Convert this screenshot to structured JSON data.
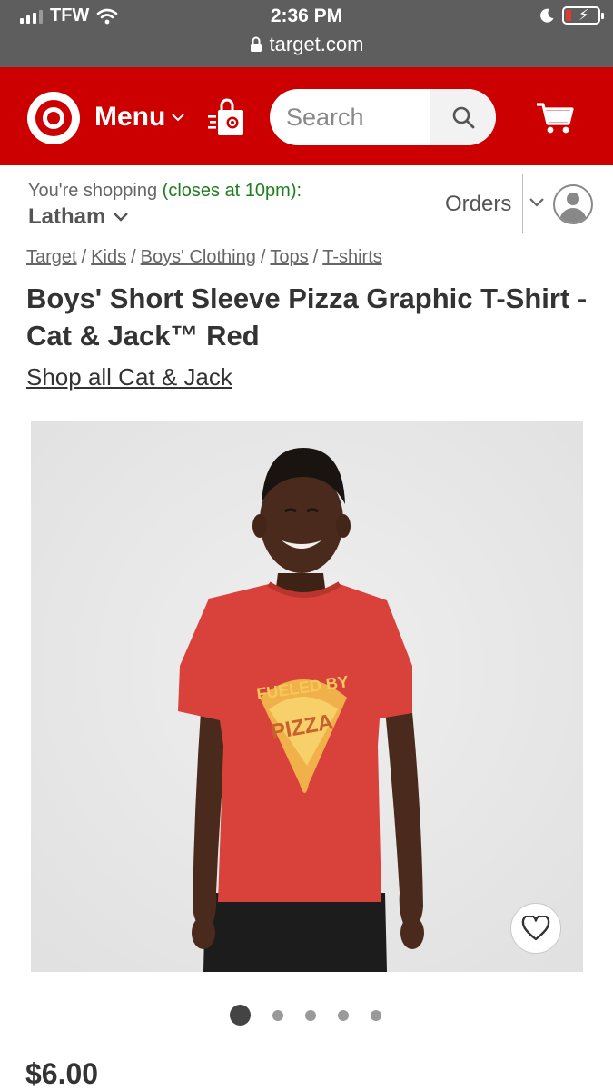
{
  "status_bar": {
    "carrier": "TFW",
    "time": "2:36 PM",
    "url": "target.com"
  },
  "header": {
    "menu_label": "Menu",
    "search_placeholder": "Search",
    "brand_color": "#cc0000"
  },
  "store": {
    "shopping_prefix": "You're shopping",
    "hours": "(closes at 10pm):",
    "store_name": "Latham",
    "orders_label": "Orders"
  },
  "breadcrumb": [
    "Target",
    "Kids",
    "Boys' Clothing",
    "Tops",
    "T-shirts"
  ],
  "product": {
    "title": "Boys' Short Sleeve Pizza Graphic T-Shirt - Cat & Jack™ Red",
    "shop_all_link": "Shop all Cat & Jack",
    "shirt_graphic_text_1": "FUELED BY",
    "shirt_graphic_text_2": "PIZZA",
    "price": "$6.00"
  },
  "carousel": {
    "total_images": 5,
    "active_index": 0
  },
  "icons": {
    "signal": "signal-icon",
    "wifi": "wifi-icon",
    "lock": "lock-icon",
    "moon": "moon-icon",
    "battery": "battery-icon",
    "logo": "target-logo",
    "bag": "shopping-bag-icon",
    "search": "search-icon",
    "cart": "cart-icon",
    "chevron": "chevron-down-icon",
    "account": "account-icon",
    "heart": "heart-icon"
  }
}
